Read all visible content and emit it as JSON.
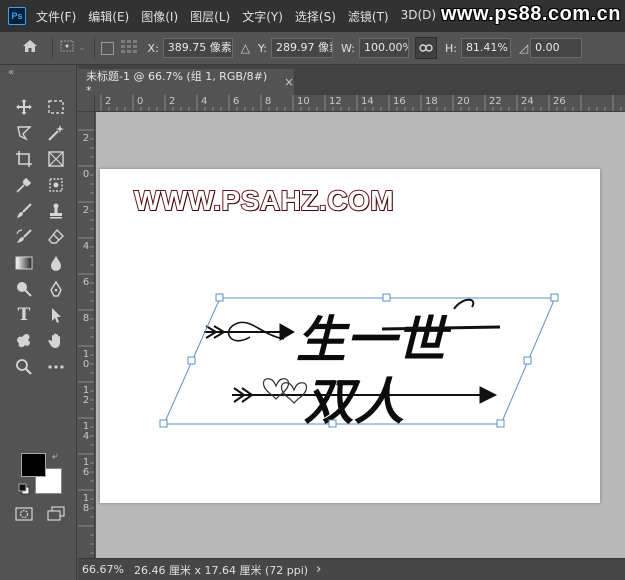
{
  "app": {
    "logo": "Ps"
  },
  "menu": [
    "文件(F)",
    "编辑(E)",
    "图像(I)",
    "图层(L)",
    "文字(Y)",
    "选择(S)",
    "滤镜(T)",
    "3D(D)"
  ],
  "watermark": "www.ps88.com.cn",
  "options": {
    "x_label": "X:",
    "x_value": "389.75 像素",
    "y_label": "Y:",
    "y_value": "289.97 像素",
    "w_label": "W:",
    "w_value": "100.00%",
    "h_label": "H:",
    "h_value": "81.41%",
    "rot_value": "0.00"
  },
  "document": {
    "tab_title": "未标题-1 @ 66.7% (组 1, RGB/8#) *",
    "close_glyph": "×",
    "site_text": "WWW.PSAHZ.COM",
    "line1": "生一世",
    "line2": "双人"
  },
  "ruler_top": [
    "2",
    "0",
    "2",
    "4",
    "6",
    "8",
    "10",
    "12",
    "14",
    "16",
    "18",
    "20",
    "22",
    "24",
    "26"
  ],
  "ruler_left": [
    "2",
    "0",
    "2",
    "4",
    "6",
    "8",
    "10",
    "12",
    "14",
    "16",
    "18"
  ],
  "status": {
    "zoom": "66.67%",
    "doc_size": "26.46 厘米 x 17.64 厘米 (72 ppi)",
    "arrow": "›"
  },
  "icons": {
    "home": "home-icon",
    "move": "move-icon",
    "marquee": "rect-marquee-icon",
    "lasso": "lasso-icon",
    "magic": "magic-wand-icon",
    "crop": "crop-icon",
    "frame": "frame-icon",
    "eyedropper": "eyedropper-icon",
    "heal": "healing-icon",
    "brush": "brush-icon",
    "stamp": "stamp-icon",
    "history": "history-brush-icon",
    "eraser": "eraser-icon",
    "gradient": "gradient-icon",
    "blur": "blur-icon",
    "dodge": "dodge-icon",
    "pen": "pen-icon",
    "type": "type-icon",
    "select": "path-select-icon",
    "shape": "custom-shape-icon",
    "hand": "hand-icon",
    "zoom": "zoom-icon",
    "more": "more-icon"
  },
  "colors": {
    "foreground": "#000000",
    "background": "#ffffff",
    "accent": "#31a8ff"
  }
}
